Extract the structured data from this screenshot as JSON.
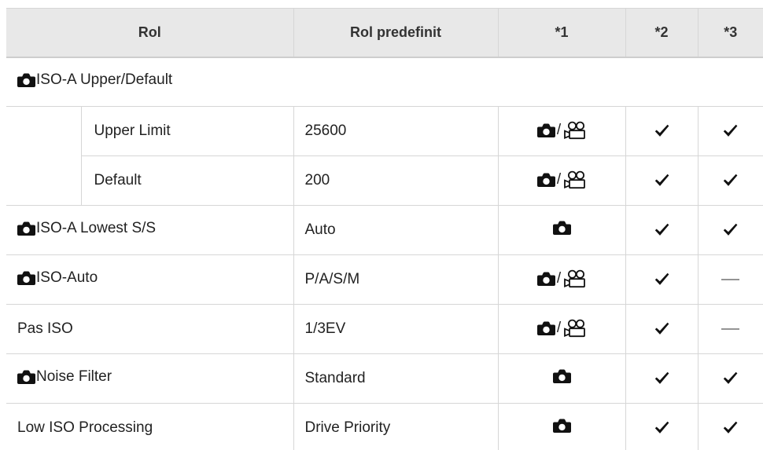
{
  "table": {
    "headers": [
      "Rol",
      "Rol predefinit",
      "*1",
      "*2",
      "*3"
    ],
    "icon_separator": "/",
    "rows": [
      {
        "type": "group",
        "icon": "camera-icon",
        "label": "ISO-A Upper/Default"
      },
      {
        "type": "sub",
        "label": "Upper Limit",
        "default": "25600",
        "star1": [
          "camera-icon",
          "movie-icon"
        ],
        "star2": "check-icon",
        "star3": "check-icon"
      },
      {
        "type": "sub",
        "label": "Default",
        "default": "200",
        "star1": [
          "camera-icon",
          "movie-icon"
        ],
        "star2": "check-icon",
        "star3": "check-icon"
      },
      {
        "type": "item",
        "icon": "camera-icon",
        "label": "ISO-A Lowest S/S",
        "default": "Auto",
        "star1": [
          "camera-icon"
        ],
        "star2": "check-icon",
        "star3": "check-icon"
      },
      {
        "type": "item",
        "icon": "camera-icon",
        "label": "ISO-Auto",
        "default": "P/A/S/M",
        "star1": [
          "camera-icon",
          "movie-icon"
        ],
        "star2": "check-icon",
        "star3": "dash-icon"
      },
      {
        "type": "item",
        "label": "Pas ISO",
        "default": "1/3EV",
        "star1": [
          "camera-icon",
          "movie-icon"
        ],
        "star2": "check-icon",
        "star3": "dash-icon"
      },
      {
        "type": "item",
        "icon": "camera-icon",
        "label": "Noise Filter",
        "default": "Standard",
        "star1": [
          "camera-icon"
        ],
        "star2": "check-icon",
        "star3": "check-icon"
      },
      {
        "type": "item",
        "label": "Low ISO Processing",
        "default": "Drive Priority",
        "star1": [
          "camera-icon"
        ],
        "star2": "check-icon",
        "star3": "check-icon"
      }
    ]
  },
  "colors": {
    "header_bg": "#e8e8e8",
    "border": "#d6d6d6",
    "text": "#222222",
    "header_text": "#333333",
    "dash": "#555555",
    "icon": "#111111"
  }
}
